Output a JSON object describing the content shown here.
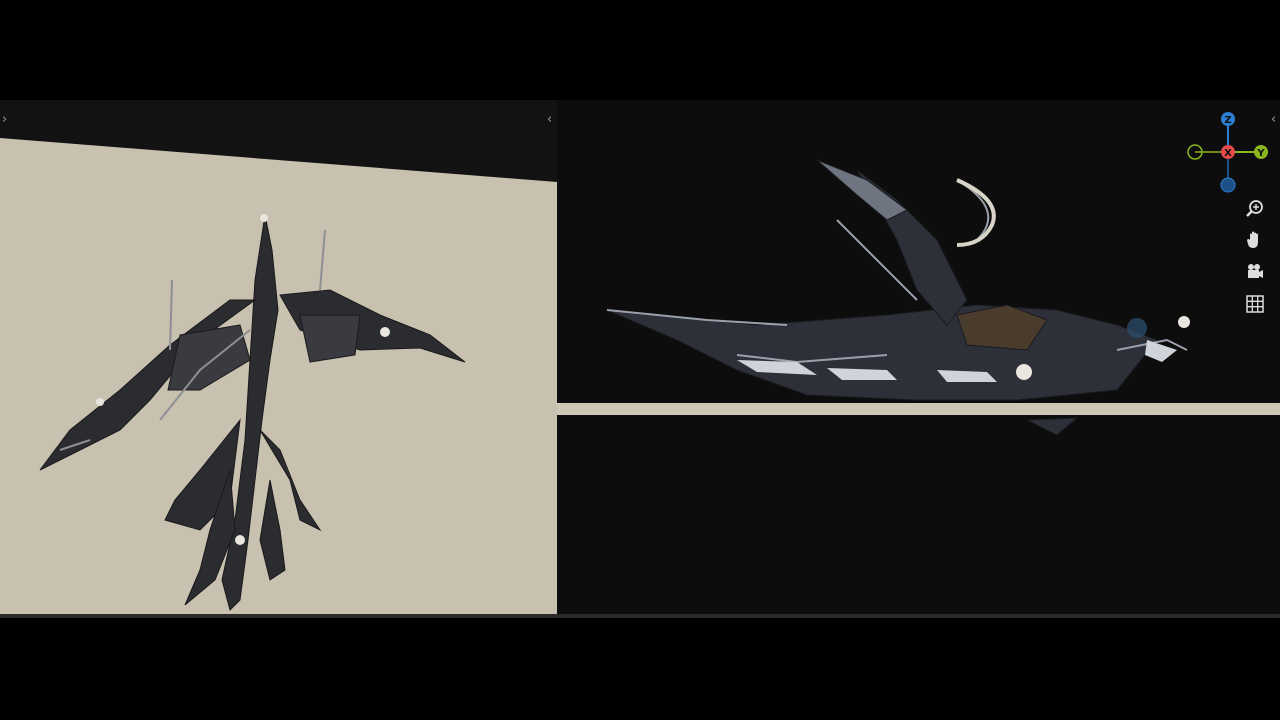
{
  "gizmo": {
    "z_label": "Z",
    "x_label": "X",
    "y_label": "Y"
  },
  "colors": {
    "axis_z": "#2e7fd6",
    "axis_x": "#e84a4a",
    "axis_y": "#8ab61f",
    "active_tool": "#4772b3",
    "ground": "#cfc7b6"
  },
  "toolbar": {
    "tools": [
      {
        "name": "select-box-icon",
        "active": false
      },
      {
        "name": "cursor-icon",
        "active": false
      },
      {
        "name": "move-icon",
        "active": true
      },
      {
        "name": "rotate-icon",
        "active": false
      },
      {
        "name": "scale-icon",
        "active": false
      },
      {
        "name": "transform-icon",
        "active": false
      },
      {
        "name": "annotate-icon",
        "active": false
      },
      {
        "name": "measure-icon",
        "active": false
      },
      {
        "name": "snap-icon",
        "active": false
      }
    ]
  },
  "navigation": [
    "zoom-icon",
    "hand-pan-icon",
    "camera-icon",
    "grid-view-icon"
  ]
}
